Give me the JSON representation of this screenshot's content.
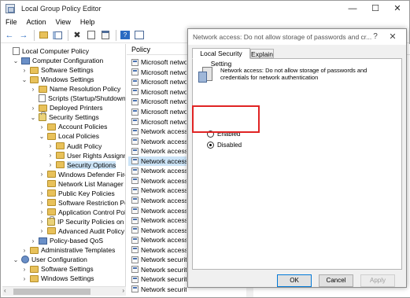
{
  "window": {
    "title": "Local Group Policy Editor",
    "minimize": "—",
    "maximize": "☐",
    "close": "✕"
  },
  "menu": [
    "File",
    "Action",
    "View",
    "Help"
  ],
  "toolbar": {
    "buttons": [
      "back-arrow-icon",
      "forward-arrow-icon",
      "folder-up-icon",
      "show-hide-tree-icon",
      "delete-icon",
      "properties-icon",
      "help-icon",
      "filter-icon"
    ]
  },
  "tree": {
    "items": [
      {
        "label": "Local Computer Policy",
        "level": 0,
        "arrow": "",
        "icon": "doc"
      },
      {
        "label": "Computer Configuration",
        "level": 1,
        "arrow": "⌄",
        "icon": "pc"
      },
      {
        "label": "Software Settings",
        "level": 2,
        "arrow": "›",
        "icon": "folder"
      },
      {
        "label": "Windows Settings",
        "level": 2,
        "arrow": "⌄",
        "icon": "folder"
      },
      {
        "label": "Name Resolution Policy",
        "level": 3,
        "arrow": "›",
        "icon": "folder"
      },
      {
        "label": "Scripts (Startup/Shutdown)",
        "level": 3,
        "arrow": "",
        "icon": "doc"
      },
      {
        "label": "Deployed Printers",
        "level": 3,
        "arrow": "›",
        "icon": "folder"
      },
      {
        "label": "Security Settings",
        "level": 3,
        "arrow": "⌄",
        "icon": "lock"
      },
      {
        "label": "Account Policies",
        "level": 4,
        "arrow": "›",
        "icon": "folder"
      },
      {
        "label": "Local Policies",
        "level": 4,
        "arrow": "⌄",
        "icon": "folder"
      },
      {
        "label": "Audit Policy",
        "level": 5,
        "arrow": "›",
        "icon": "folder"
      },
      {
        "label": "User Rights Assignment",
        "level": 5,
        "arrow": "›",
        "icon": "folder"
      },
      {
        "label": "Security Options",
        "level": 5,
        "arrow": "›",
        "icon": "folder",
        "selected": true
      },
      {
        "label": "Windows Defender Firewall",
        "level": 4,
        "arrow": "›",
        "icon": "folder"
      },
      {
        "label": "Network List Manager",
        "level": 4,
        "arrow": "",
        "icon": "folder"
      },
      {
        "label": "Public Key Policies",
        "level": 4,
        "arrow": "›",
        "icon": "folder"
      },
      {
        "label": "Software Restriction Policies",
        "level": 4,
        "arrow": "›",
        "icon": "folder"
      },
      {
        "label": "Application Control Policies",
        "level": 4,
        "arrow": "›",
        "icon": "folder"
      },
      {
        "label": "IP Security Policies on",
        "level": 4,
        "arrow": "›",
        "icon": "lock"
      },
      {
        "label": "Advanced Audit Policy",
        "level": 4,
        "arrow": "›",
        "icon": "folder"
      },
      {
        "label": "Policy-based QoS",
        "level": 3,
        "arrow": "›",
        "icon": "pc"
      },
      {
        "label": "Administrative Templates",
        "level": 2,
        "arrow": "›",
        "icon": "folder"
      },
      {
        "label": "User Configuration",
        "level": 1,
        "arrow": "⌄",
        "icon": "user"
      },
      {
        "label": "Software Settings",
        "level": 2,
        "arrow": "›",
        "icon": "folder"
      },
      {
        "label": "Windows Settings",
        "level": 2,
        "arrow": "›",
        "icon": "folder"
      }
    ]
  },
  "list": {
    "header": "Policy",
    "rows": [
      "Microsoft network",
      "Microsoft network",
      "Microsoft network",
      "Microsoft network",
      "Microsoft network",
      "Microsoft network",
      "Microsoft network",
      "Network access: A",
      "Network access: A",
      "Network access: D",
      "Network access: D",
      "Network access: L",
      "Network access: N",
      "Network access: R",
      "Network access: R",
      "Network access: R",
      "Network access: R",
      "Network access: S",
      "Network access: S",
      "Network access: S",
      "Network security:",
      "Network security:",
      "Network security:",
      "Network security:"
    ],
    "selected_index": 10
  },
  "dialog": {
    "title": "Network access: Do not allow storage of passwords and cr...",
    "help": "?",
    "close": "✕",
    "tabs": [
      "Local Security Setting",
      "Explain"
    ],
    "active_tab": 0,
    "description": "Network access: Do not allow storage of passwords and credentials for network authentication",
    "options": {
      "enabled_label": "Enabled",
      "disabled_label": "Disabled",
      "selected": "Disabled"
    },
    "buttons": {
      "ok": "OK",
      "cancel": "Cancel",
      "apply": "Apply"
    },
    "highlight_color": "#e02424"
  }
}
